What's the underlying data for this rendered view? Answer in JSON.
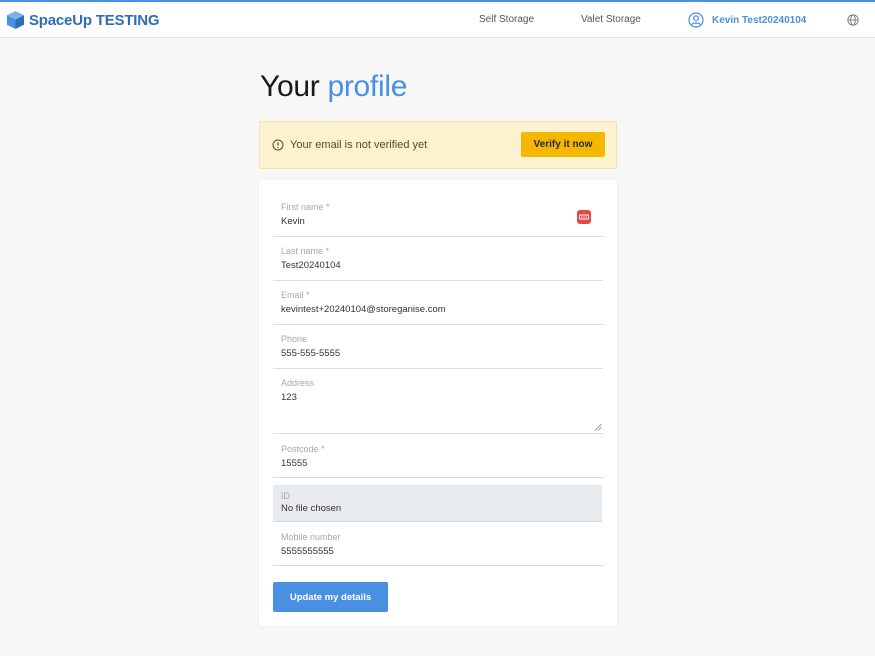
{
  "header": {
    "brand": "SpaceUp TESTING",
    "nav": [
      "Self Storage",
      "Valet Storage"
    ],
    "user_name": "Kevin Test20240104"
  },
  "page": {
    "title_part1": "Your",
    "title_part2": "profile"
  },
  "alert": {
    "message": "Your email is not verified yet",
    "action_label": "Verify it now"
  },
  "form": {
    "first_name": {
      "label": "First name *",
      "value": "Kevin"
    },
    "last_name": {
      "label": "Last name *",
      "value": "Test20240104"
    },
    "email": {
      "label": "Email *",
      "value": "kevintest+20240104@storeganise.com"
    },
    "phone": {
      "label": "Phone",
      "value": "555-555-5555"
    },
    "address": {
      "label": "Address",
      "value": "123"
    },
    "postcode": {
      "label": "Postcode *",
      "value": "15555"
    },
    "id_file": {
      "label": "ID",
      "value": "No file chosen"
    },
    "mobile": {
      "label": "Mobile number",
      "value": "5555555555"
    },
    "submit_label": "Update my details"
  },
  "colors": {
    "accent": "#4a90e2",
    "brand": "#2e6db3",
    "warning_bg": "#fdf2cf",
    "warning_button": "#f5b800"
  }
}
